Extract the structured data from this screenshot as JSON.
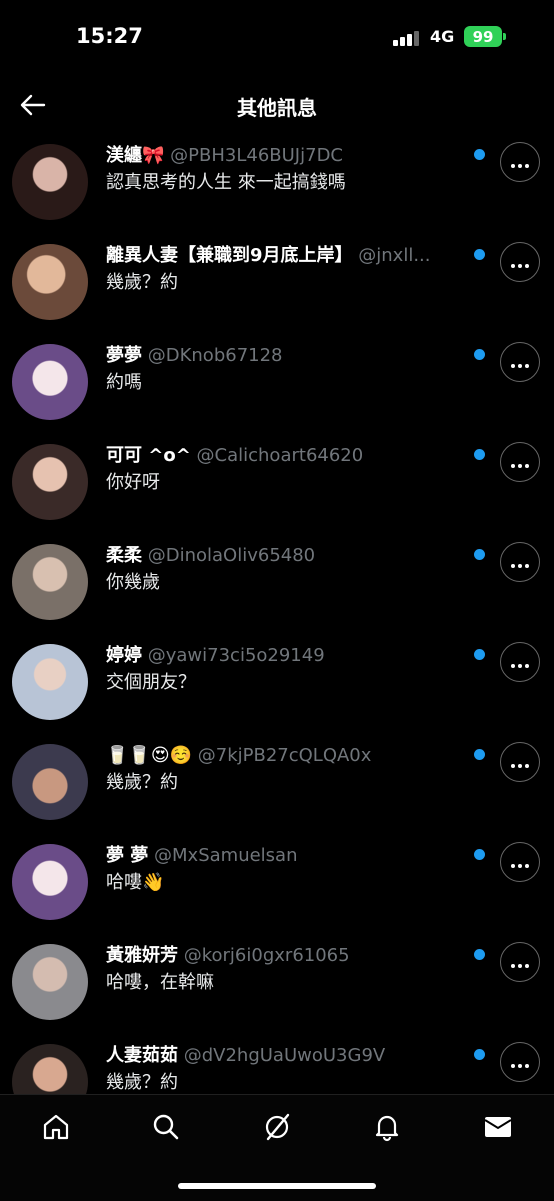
{
  "status": {
    "time": "15:27",
    "network": "4G",
    "battery": "99"
  },
  "header": {
    "title": "其他訊息"
  },
  "colors": {
    "unread_dot": "#1d9bf0",
    "handle": "#71767b",
    "battery": "#30d158"
  },
  "conversations": [
    {
      "name": "渼纏🎀",
      "handle": "@PBH3L46BUJj7DC",
      "message": "認真思考的人生 來一起搞錢嗎",
      "unread": true
    },
    {
      "name": "離異人妻【兼職到9月底上岸】",
      "handle": "@jnxll...",
      "message": "幾歲？約",
      "unread": true
    },
    {
      "name": "夢夢",
      "handle": "@DKnob67128",
      "message": "約嗎",
      "unread": true
    },
    {
      "name": "可可 ^o^",
      "handle": "@Calichoart64620",
      "message": "你好呀",
      "unread": true
    },
    {
      "name": "柔柔",
      "handle": "@DinolaOliv65480",
      "message": "你幾歲",
      "unread": true
    },
    {
      "name": "婷婷",
      "handle": "@yawi73ci5o29149",
      "message": "交個朋友？",
      "unread": true
    },
    {
      "name": "🥛🥛😍☺️",
      "handle": "@7kjPB27cQLQA0x",
      "message": "幾歲？約",
      "unread": true
    },
    {
      "name": "夢 夢",
      "handle": "@MxSamuelsan",
      "message": "哈嘍👋",
      "unread": true
    },
    {
      "name": "黃雅妍芳",
      "handle": "@korj6i0gxr61065",
      "message": "哈嘍，在幹嘛",
      "unread": true
    },
    {
      "name": "人妻茹茹",
      "handle": "@dV2hgUaUwoU3G9V",
      "message": "幾歲？約",
      "unread": true
    }
  ],
  "tabs": [
    "home-icon",
    "search-icon",
    "grok-icon",
    "bell-icon",
    "mail-icon"
  ]
}
